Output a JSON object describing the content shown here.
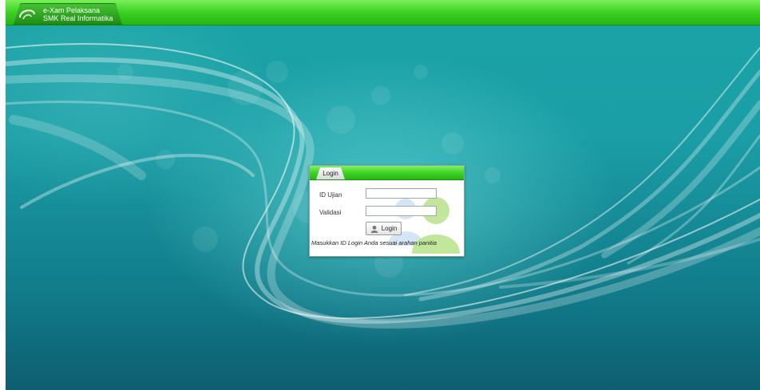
{
  "header": {
    "title": "e-Xam Pelaksana",
    "subtitle": "SMK Real Informatika",
    "logo_icon": "swirl-logo-icon"
  },
  "login": {
    "tab_label": "Login",
    "id_label": "ID Ujian",
    "id_value": "",
    "validation_label": "Validasi",
    "validation_value": "",
    "button_label": "Login",
    "button_icon": "user-icon",
    "note": "Masukkan ID Login Anda sesuai arahan panitia",
    "background_icon": "users-icon"
  },
  "colors": {
    "bar_green": "#3fd426",
    "background_teal": "#1a9ea6",
    "panel_bg": "#ffffff"
  }
}
